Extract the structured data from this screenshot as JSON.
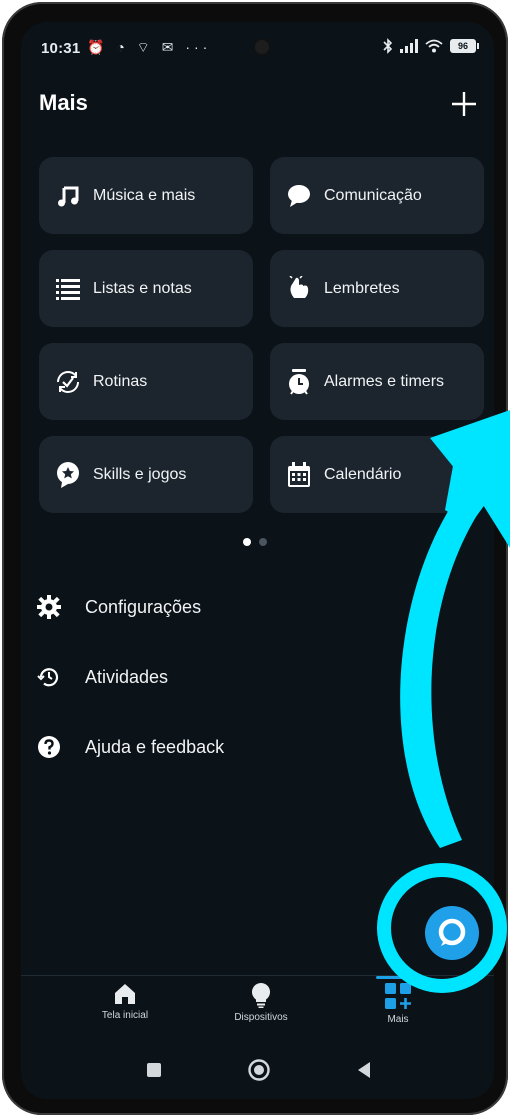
{
  "status_bar": {
    "time": "10:31",
    "left_icons": "⏰ ◔ ⌔ ✉ ···",
    "battery": "96"
  },
  "header": {
    "title": "Mais"
  },
  "grid": [
    {
      "label": "Música e mais",
      "icon": "music-note-icon"
    },
    {
      "label": "Comunicação",
      "icon": "chat-bubble-icon"
    },
    {
      "label": "Listas e notas",
      "icon": "list-icon"
    },
    {
      "label": "Lembretes",
      "icon": "reminder-hand-icon"
    },
    {
      "label": "Rotinas",
      "icon": "routine-icon"
    },
    {
      "label": "Alarmes e timers",
      "icon": "alarm-timer-icon"
    },
    {
      "label": "Skills e jogos",
      "icon": "skills-icon"
    },
    {
      "label": "Calendário",
      "icon": "calendar-icon"
    }
  ],
  "pagination": {
    "active_index": 0,
    "count": 2
  },
  "menu": [
    {
      "label": "Configurações",
      "icon": "gear-icon"
    },
    {
      "label": "Atividades",
      "icon": "history-icon"
    },
    {
      "label": "Ajuda e feedback",
      "icon": "help-icon"
    }
  ],
  "bottom_nav": {
    "tabs": [
      {
        "label": "Tela inicial",
        "icon": "home-icon"
      },
      {
        "label": "Dispositivos",
        "icon": "bulb-icon"
      },
      {
        "label": "Mais",
        "icon": "more-grid-icon",
        "active": true
      }
    ]
  },
  "colors": {
    "accent": "#1ea0e6",
    "highlight": "#00e5ff",
    "background": "#0b1218",
    "card": "#1c252d"
  }
}
